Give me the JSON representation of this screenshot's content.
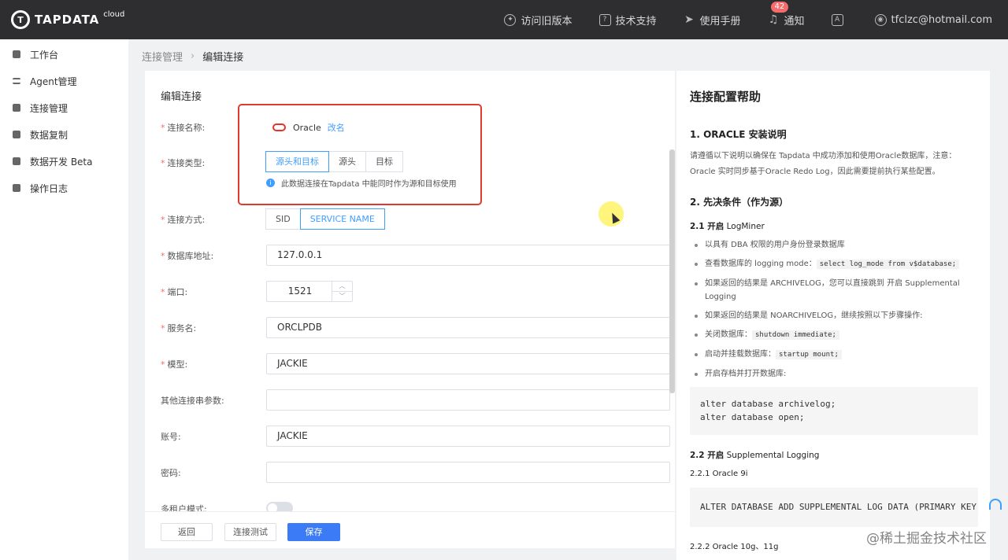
{
  "header": {
    "logo_text": "TAPDATA",
    "logo_sup": "cloud",
    "items": [
      {
        "label": "访问旧版本",
        "icon": "compass-icon"
      },
      {
        "label": "技术支持",
        "icon": "help-icon"
      },
      {
        "label": "使用手册",
        "icon": "paper-plane-icon"
      },
      {
        "label": "通知",
        "icon": "bell-icon",
        "badge": "42"
      },
      {
        "label": "",
        "icon": "language-icon"
      },
      {
        "label": "tfclzc@hotmail.com",
        "icon": "user-icon"
      }
    ]
  },
  "sidebar": {
    "items": [
      {
        "label": "工作台"
      },
      {
        "label": "Agent管理"
      },
      {
        "label": "连接管理"
      },
      {
        "label": "数据复制"
      },
      {
        "label": "数据开发 Beta"
      },
      {
        "label": "操作日志"
      }
    ]
  },
  "breadcrumb": {
    "parent": "连接管理",
    "current": "编辑连接"
  },
  "form": {
    "title": "编辑连接",
    "labels": {
      "name": "连接名称:",
      "type": "连接类型:",
      "method": "连接方式:",
      "host": "数据库地址:",
      "port": "端口:",
      "service": "服务名:",
      "schema": "模型:",
      "extra": "其他连接串参数:",
      "account": "账号:",
      "password": "密码:",
      "multitenant": "多租户模式:"
    },
    "oracle_name": "Oracle",
    "rename": "改名",
    "type_options": [
      "源头和目标",
      "源头",
      "目标"
    ],
    "type_selected": "源头和目标",
    "type_hint": "此数据连接在Tapdata 中能同时作为源和目标使用",
    "method_options": [
      "SID",
      "SERVICE NAME"
    ],
    "method_selected": "SERVICE NAME",
    "host": "127.0.0.1",
    "port": "1521",
    "service": "ORCLPDB",
    "schema": "JACKIE",
    "extra": "",
    "account": "JACKIE",
    "password": "",
    "buttons": {
      "back": "返回",
      "test": "连接测试",
      "save": "保存"
    }
  },
  "help": {
    "title": "连接配置帮助",
    "s1_title": "1. ORACLE 安装说明",
    "s1_text": "请遵循以下说明以确保在 Tapdata 中成功添加和使用Oracle数据库，注意：Oracle 实时同步基于Oracle Redo Log，因此需要提前执行某些配置。",
    "s2_title": "2. 先决条件（作为源）",
    "s21_prefix": "2.1 开启",
    "s21_rest": " LogMiner",
    "bullets": [
      {
        "text": "以具有 DBA 权限的用户身份登录数据库",
        "code": ""
      },
      {
        "text": "查看数据库的 logging mode：",
        "code": "select log_mode from v$database;"
      },
      {
        "text": "如果返回的结果是 ARCHIVELOG，您可以直接跳到 开启 Supplemental Logging",
        "code": ""
      },
      {
        "text": "如果返回的结果是 NOARCHIVELOG，继续按照以下步骤操作:",
        "code": ""
      },
      {
        "text": "关闭数据库：",
        "code": "shutdown immediate;"
      },
      {
        "text": "启动并挂载数据库：",
        "code": "startup mount;"
      },
      {
        "text": "开启存档并打开数据库:",
        "code": ""
      }
    ],
    "code1": "alter database archivelog;\nalter database open;",
    "s22_prefix": "2.2 开启",
    "s22_rest": " Supplemental Logging",
    "s221": "2.2.1 Oracle 9i",
    "code2": "ALTER DATABASE ADD SUPPLEMENTAL LOG DATA (PRIMARY KEY) COLUMNS;",
    "s222": "2.2.2 Oracle 10g、11g"
  },
  "watermark": "@稀土掘金技术社区",
  "colors": {
    "accent": "#409eff",
    "primary_button": "#3b7cf6",
    "highlight_box": "#e03a2f",
    "oracle": "#e0362a",
    "header_bg": "#2e2e30"
  }
}
